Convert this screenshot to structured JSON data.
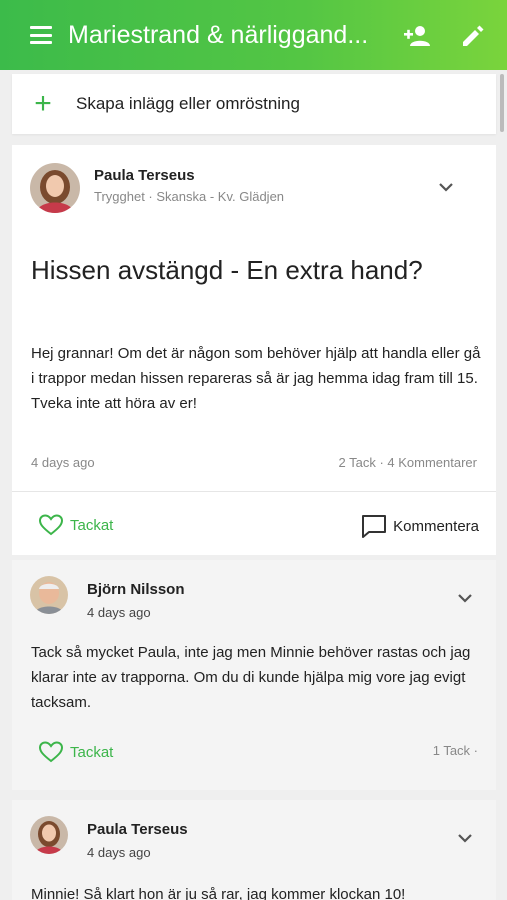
{
  "header": {
    "title": "Mariestrand & närliggand...",
    "menu_icon": "menu-icon",
    "add_person_icon": "person-add-icon",
    "edit_icon": "pencil-icon"
  },
  "composer": {
    "label": "Skapa inlägg eller omröstning",
    "icon": "plus-icon"
  },
  "post": {
    "author": "Paula Terseus",
    "meta": "Trygghet · Skanska - Kv. Glädjen",
    "title": "Hissen avstängd - En extra hand?",
    "body": "Hej grannar! Om det är någon som behöver hjälp att handla eller gå i trappor medan hissen repareras så är jag hemma idag fram till 15. Tveka inte att höra av er!",
    "time": "4 days ago",
    "stats": "2 Tack · 4 Kommentarer",
    "like_label": "Tackat",
    "comment_label": "Kommentera"
  },
  "comments": [
    {
      "author": "Björn Nilsson",
      "time": "4 days ago",
      "text": "Tack så mycket Paula, inte jag men Minnie behöver rastas och jag klarar inte av trapporna. Om du di kunde hjälpa mig vore jag evigt tacksam.",
      "like_label": "Tackat",
      "stats": "1 Tack ·"
    },
    {
      "author": "Paula Terseus",
      "time": "4 days ago",
      "text": "Minnie! Så klart hon är ju så rar, jag kommer klockan 10!"
    }
  ],
  "colors": {
    "accent": "#3cb54a",
    "header_gradient_start": "#3cbb4a",
    "header_gradient_end": "#7ad43c"
  }
}
